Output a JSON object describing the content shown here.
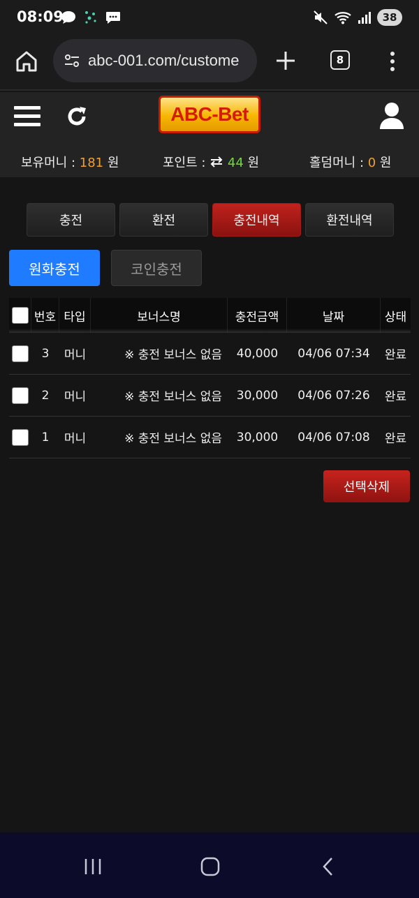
{
  "status_bar": {
    "time": "08:09",
    "battery": "38",
    "left_icons": [
      "chat-bubble-icon",
      "dots-icon",
      "message-icon"
    ],
    "right_icons": [
      "mute-icon",
      "wifi-icon",
      "signal-icon"
    ]
  },
  "browser": {
    "url": "abc-001.com/custome",
    "tab_count": "8"
  },
  "header": {
    "logo_text": "ABC-Bet"
  },
  "balance": {
    "money_label": "보유머니 : ",
    "money_value": "181",
    "money_unit": " 원",
    "point_label": "포인트 : ",
    "point_value": "44",
    "point_unit": " 원",
    "holdem_label": "홀덤머니 : ",
    "holdem_value": "0",
    "holdem_unit": " 원"
  },
  "tabs": [
    "충전",
    "환전",
    "충전내역",
    "환전내역"
  ],
  "active_tab": "충전내역",
  "subtabs": [
    "원화충전",
    "코인충전"
  ],
  "table": {
    "headers": [
      "번호",
      "타입",
      "보너스명",
      "충전금액",
      "날짜",
      "상태"
    ],
    "rows": [
      {
        "no": "3",
        "type": "머니",
        "bonus": "※ 충전 보너스 없음",
        "amount": "40,000",
        "date": "04/06 07:34",
        "status": "완료"
      },
      {
        "no": "2",
        "type": "머니",
        "bonus": "※ 충전 보너스 없음",
        "amount": "30,000",
        "date": "04/06 07:26",
        "status": "완료"
      },
      {
        "no": "1",
        "type": "머니",
        "bonus": "※ 충전 보너스 없음",
        "amount": "30,000",
        "date": "04/06 07:08",
        "status": "완료"
      }
    ]
  },
  "delete_button": "선택삭제",
  "colors": {
    "accent_red": "#b01d18",
    "accent_blue": "#1f7bff",
    "money_orange": "#f0a030",
    "point_green": "#6ddc3a"
  }
}
